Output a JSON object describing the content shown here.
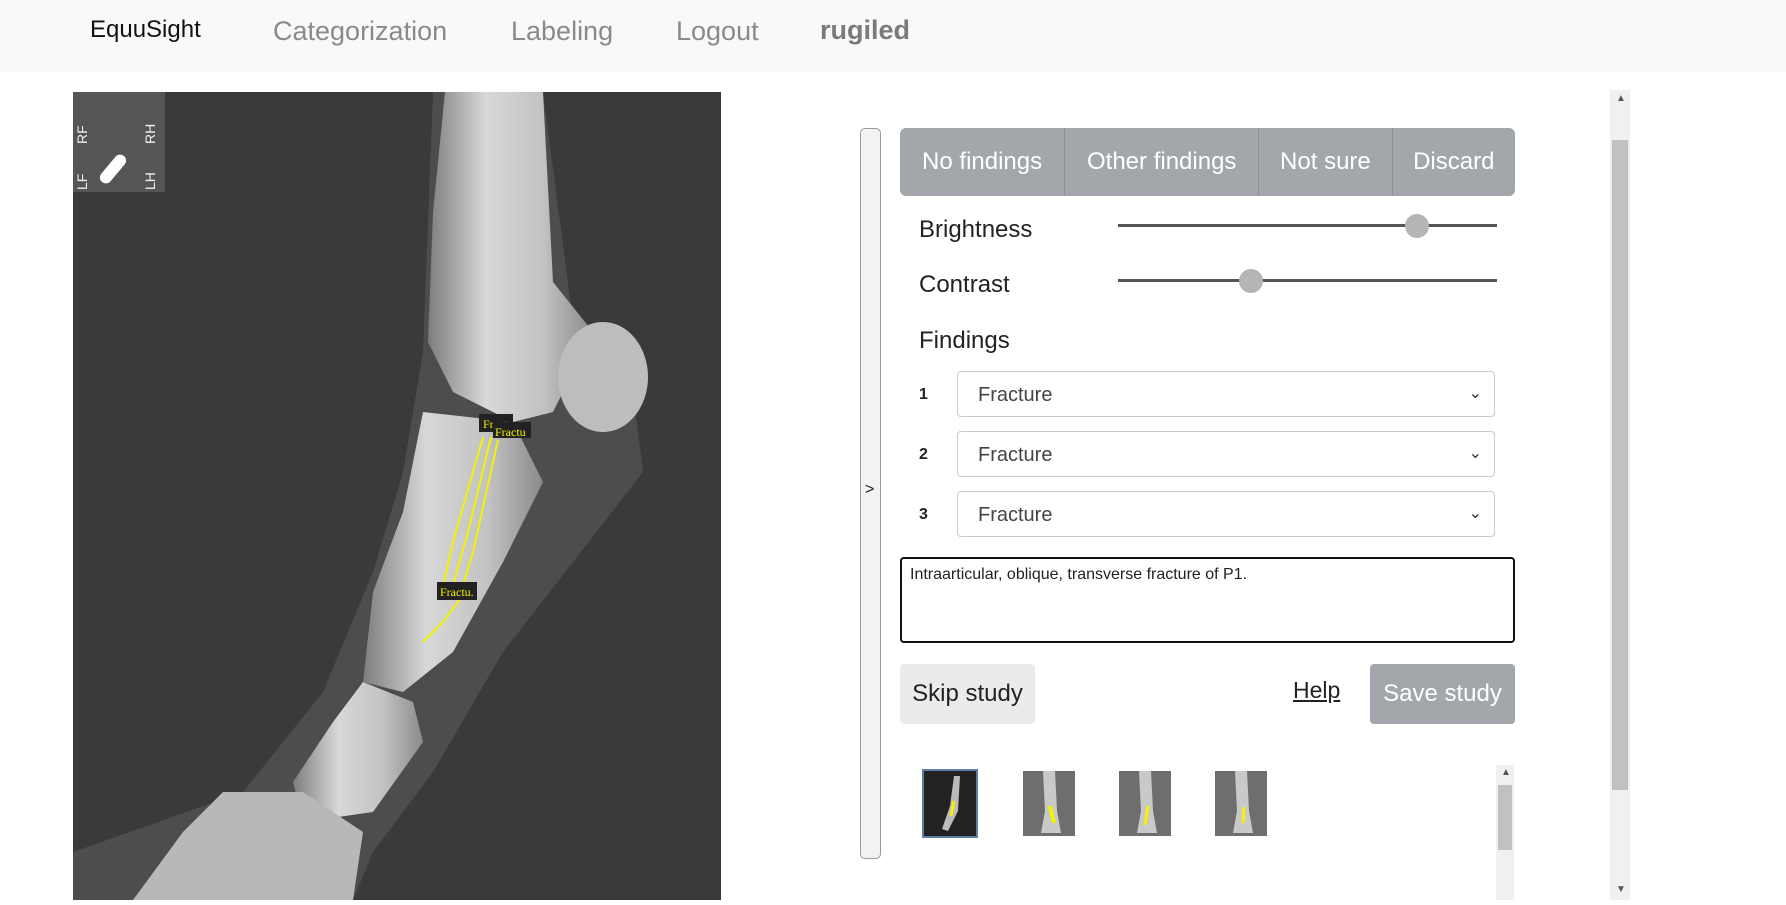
{
  "nav": {
    "brand": "EquuSight",
    "links": [
      "Categorization",
      "Labeling",
      "Logout"
    ],
    "user": "rugiled"
  },
  "image": {
    "markers": [
      "RF",
      "RH",
      "LF",
      "LH"
    ],
    "annotations": [
      "Fract.",
      "Fractu",
      "Fractu."
    ]
  },
  "toggle": {
    "label": ">"
  },
  "decision_buttons": [
    "No findings",
    "Other findings",
    "Not sure",
    "Discard"
  ],
  "adjustments": {
    "brightness": {
      "label": "Brightness",
      "value_fraction": 0.79
    },
    "contrast": {
      "label": "Contrast",
      "value_fraction": 0.35
    }
  },
  "findings": {
    "heading": "Findings",
    "items": [
      {
        "num": "1",
        "value": "Fracture"
      },
      {
        "num": "2",
        "value": "Fracture"
      },
      {
        "num": "3",
        "value": "Fracture"
      }
    ]
  },
  "notes": {
    "value": "Intraarticular, oblique,  transverse fracture of P1."
  },
  "actions": {
    "skip": "Skip study",
    "help": "Help",
    "save": "Save study"
  },
  "thumbnails": {
    "count": 4,
    "active_index": 0
  },
  "colors": {
    "accent": "#a3a7ac",
    "annotation": "#f5f200",
    "navbar": "#f8f9fa"
  },
  "icons": [
    "chevron-down-icon",
    "scroll-up-arrow-icon",
    "scroll-down-arrow-icon"
  ]
}
